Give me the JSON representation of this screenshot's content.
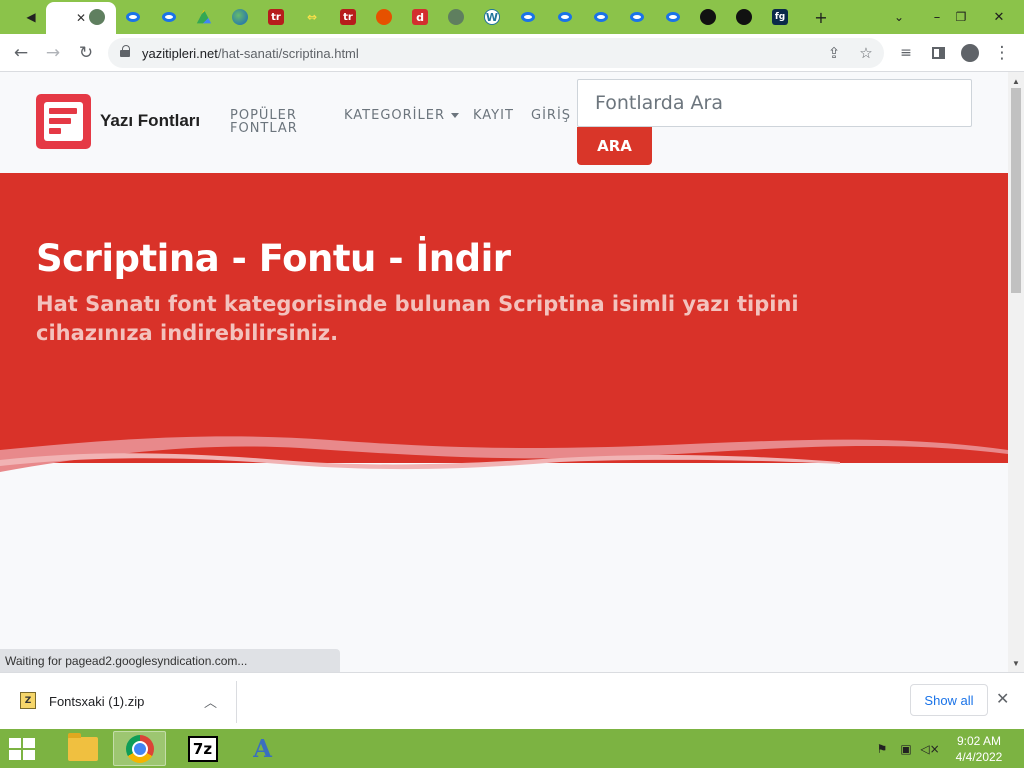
{
  "browser": {
    "tab_active_close": "✕",
    "url_domain": "yazitipleri.net",
    "url_path": "/hat-sanati/scriptina.html",
    "new_tab": "+"
  },
  "site": {
    "brand": "Yazı Fontları",
    "nav": {
      "popular_line1": "POPÜLER",
      "popular_line2": "FONTLAR",
      "categories": "KATEGORİLER",
      "register": "KAYIT",
      "login": "GİRİŞ"
    },
    "search": {
      "placeholder": "Fontlarda Ara",
      "button": "ARA"
    },
    "hero": {
      "title": "Scriptina - Fontu - İndir",
      "subtitle": "Hat Sanatı font kategorisinde bulunan Scriptina isimli yazı tipini cihazınıza indirebilirsiniz."
    },
    "colors": {
      "brand_red": "#e53945",
      "hero_red": "#d93229",
      "button_red": "#d93629"
    }
  },
  "status": {
    "text": "Waiting for pagead2.googlesyndication.com..."
  },
  "downloads": {
    "file_name": "Fontsxaki (1).zip",
    "show_all": "Show all"
  },
  "taskbar": {
    "sevenzip_label": "7z",
    "time": "9:02 AM",
    "date": "4/4/2022"
  }
}
